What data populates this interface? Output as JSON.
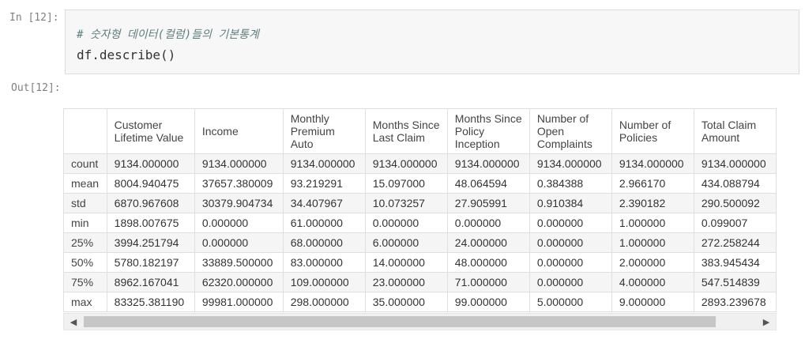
{
  "cell": {
    "in_prompt": "In [12]:",
    "out_prompt": "Out[12]:",
    "code_comment": "# 숫자형 데이터(컬럼)들의 기본통계",
    "code_line": "df.describe()"
  },
  "table": {
    "columns": [
      "",
      "Customer Lifetime Value",
      "Income",
      "Monthly Premium Auto",
      "Months Since Last Claim",
      "Months Since Policy Inception",
      "Number of Open Complaints",
      "Number of Policies",
      "Total Claim Amount"
    ],
    "rows": [
      {
        "label": "count",
        "values": [
          "9134.000000",
          "9134.000000",
          "9134.000000",
          "9134.000000",
          "9134.000000",
          "9134.000000",
          "9134.000000",
          "9134.000000"
        ]
      },
      {
        "label": "mean",
        "values": [
          "8004.940475",
          "37657.380009",
          "93.219291",
          "15.097000",
          "48.064594",
          "0.384388",
          "2.966170",
          "434.088794"
        ]
      },
      {
        "label": "std",
        "values": [
          "6870.967608",
          "30379.904734",
          "34.407967",
          "10.073257",
          "27.905991",
          "0.910384",
          "2.390182",
          "290.500092"
        ]
      },
      {
        "label": "min",
        "values": [
          "1898.007675",
          "0.000000",
          "61.000000",
          "0.000000",
          "0.000000",
          "0.000000",
          "1.000000",
          "0.099007"
        ]
      },
      {
        "label": "25%",
        "values": [
          "3994.251794",
          "0.000000",
          "68.000000",
          "6.000000",
          "24.000000",
          "0.000000",
          "1.000000",
          "272.258244"
        ]
      },
      {
        "label": "50%",
        "values": [
          "5780.182197",
          "33889.500000",
          "83.000000",
          "14.000000",
          "48.000000",
          "0.000000",
          "2.000000",
          "383.945434"
        ]
      },
      {
        "label": "75%",
        "values": [
          "8962.167041",
          "62320.000000",
          "109.000000",
          "23.000000",
          "71.000000",
          "0.000000",
          "4.000000",
          "547.514839"
        ]
      },
      {
        "label": "max",
        "values": [
          "83325.381190",
          "99981.000000",
          "298.000000",
          "35.000000",
          "99.000000",
          "5.000000",
          "9.000000",
          "2893.239678"
        ]
      }
    ]
  },
  "scrollbar": {
    "left_icon": "arrow-left-icon",
    "right_icon": "arrow-right-icon"
  }
}
